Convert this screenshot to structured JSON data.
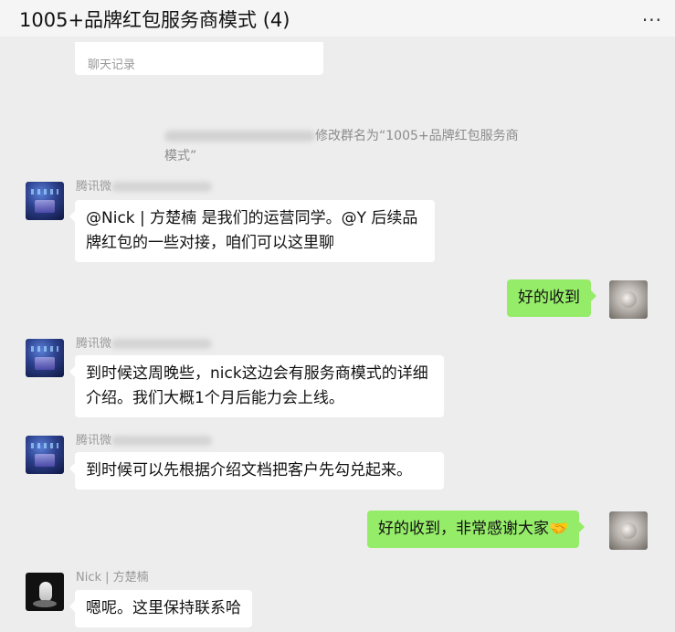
{
  "header": {
    "title": "1005+品牌红包服务商模式 (4)",
    "more_icon": "···"
  },
  "shared_card": {
    "label": "聊天记录"
  },
  "system_notice": {
    "text": "修改群名为“1005+品牌红包服务商模式”"
  },
  "messages": [
    {
      "sender": "腾讯微信支付品牌经理",
      "side": "left",
      "text": "@Nick | 方楚楠 是我们的运营同学。@Y 后续品牌红包的一些对接，咱们可以这里聊"
    },
    {
      "sender": "",
      "side": "right",
      "text": "好的收到"
    },
    {
      "sender": "腾讯微信支付品牌经理",
      "side": "left",
      "text": "到时候这周晚些，nick这边会有服务商模式的详细介绍。我们大概1个月后能力会上线。"
    },
    {
      "sender": "腾讯微信支付品牌经理",
      "side": "left",
      "text": "到时候可以先根据介绍文档把客户先勾兑起来。"
    },
    {
      "sender": "",
      "side": "right",
      "text": "好的收到，非常感谢大家🤝"
    },
    {
      "sender": "Nick | 方楚楠",
      "side": "left",
      "text": "嗯呢。这里保持联系哈"
    }
  ],
  "sender_prefix": "腾讯微"
}
